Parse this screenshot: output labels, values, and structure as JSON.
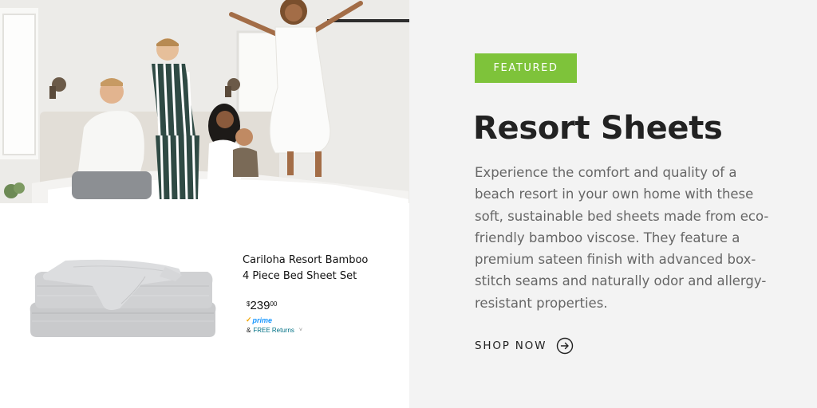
{
  "hero": {
    "image_subject": "family-jumping-on-bed-photo"
  },
  "product": {
    "title_line1": "Cariloha Resort Bamboo",
    "title_line2": "4 Piece Bed Sheet Set",
    "price_symbol": "$",
    "price_whole": "239",
    "price_fraction": "00",
    "prime_label": "prime",
    "returns_prefix": "&",
    "returns_link": "FREE Returns",
    "returns_chevron": "˅"
  },
  "feature": {
    "badge": "FEATURED",
    "title": "Resort Sheets",
    "description": "Experience the comfort and quality of a beach resort in your own home with these soft, sustainable bed sheets made from eco-friendly bamboo viscose. They feature a premium sateen finish with advanced box-stitch seams and naturally odor and allergy-resistant properties.",
    "cta_label": "SHOP NOW",
    "cta_icon": "arrow-circle-right-icon"
  },
  "colors": {
    "badge_bg": "#7ec33a",
    "panel_bg": "#f3f3f3",
    "heading": "#222222",
    "body_text": "#666666",
    "prime_blue": "#1a98ff",
    "returns_link": "#007185"
  }
}
